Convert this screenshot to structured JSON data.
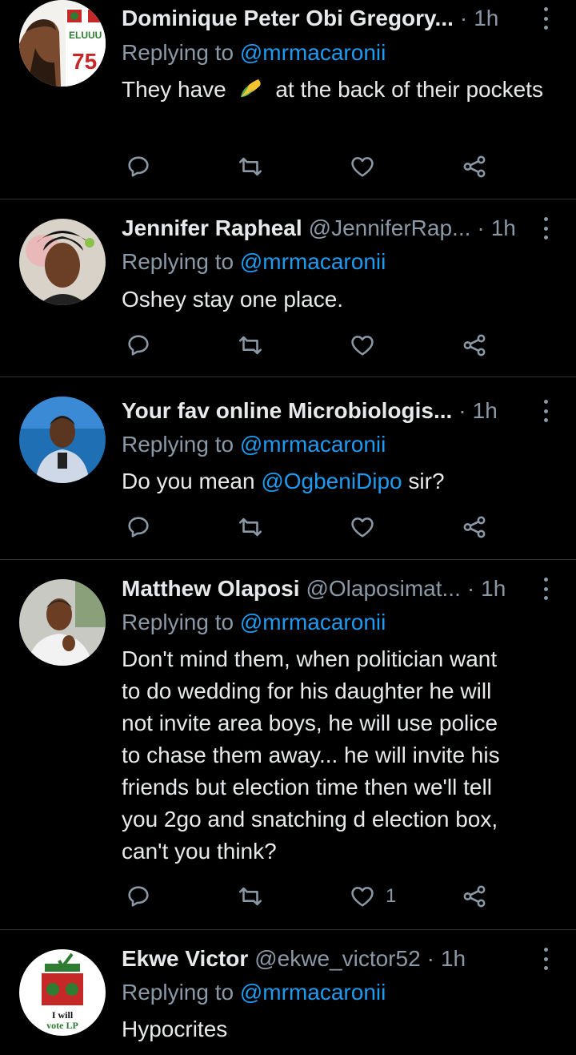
{
  "tweets": [
    {
      "name": "Dominique Peter Obi Gregory...",
      "handle": "",
      "time": "1h",
      "replying_prefix": "Replying to",
      "replying_to": "@mrmacaronii",
      "body_parts": [
        "They have",
        "at the back of their pockets"
      ],
      "emoji": "corn",
      "like_count": "",
      "avatar_text": [
        "ELUUU P!",
        "75"
      ]
    },
    {
      "name": "Jennifer Rapheal",
      "handle": "@JenniferRap...",
      "time": "1h",
      "replying_prefix": "Replying to",
      "replying_to": "@mrmacaronii",
      "body": "Oshey stay one place.",
      "like_count": ""
    },
    {
      "name": "Your fav online Microbiologis...",
      "handle": "",
      "time": "1h",
      "replying_prefix": "Replying to",
      "replying_to": "@mrmacaronii",
      "body_prefix": "Do you mean",
      "body_mention": "@OgbeniDipo",
      "body_suffix": "sir?",
      "like_count": ""
    },
    {
      "name": "Matthew Olaposi",
      "handle": "@Olaposimat...",
      "time": "1h",
      "replying_prefix": "Replying to",
      "replying_to": "@mrmacaronii",
      "body_lines": [
        "Don't mind them, when politician want",
        "to do  wedding for his daughter he will",
        "not invite area boys, he will use police",
        "to chase them away... he will invite his",
        "friends but election time then we'll tell",
        "you 2go and  snatching d election box,",
        "can't you think?"
      ],
      "like_count": "1"
    },
    {
      "name": "Ekwe Victor",
      "handle": "@ekwe_victor52",
      "time": "1h",
      "replying_prefix": "Replying to",
      "replying_to": "@mrmacaronii",
      "body": "Hypocrites",
      "avatar_text": [
        "I will",
        "vote LP"
      ]
    }
  ],
  "separator": "·",
  "colors": {
    "background": "#000000",
    "text": "#e7e9ea",
    "muted": "#8b98a5",
    "link": "#1d9bf0",
    "border": "#2f3336"
  }
}
